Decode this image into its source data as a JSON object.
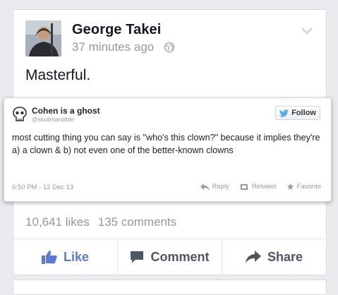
{
  "post": {
    "author": "George Takei",
    "time": "37 minutes ago",
    "text": "Masterful.",
    "likes": "10,641 likes",
    "comments": "135 comments"
  },
  "tweet": {
    "name": "Cohen is a ghost",
    "handle": "@skullmandible",
    "follow_label": "Follow",
    "text": "most cutting thing you can say is \"who's this clown?\" because it implies they're a) a clown & b) not even one of the better-known clowns",
    "date": "6:50 PM - 12 Dec 13",
    "reply_label": "Reply",
    "retweet_label": "Retweet",
    "favorite_label": "Favorite"
  },
  "actions": {
    "like": "Like",
    "comment": "Comment",
    "share": "Share"
  },
  "colors": {
    "accent_blue": "#5b7bd5",
    "twitter_blue": "#55acee",
    "muted_text": "#9197a3"
  },
  "icons": [
    "globe-icon",
    "chevron-down-icon",
    "skull-icon",
    "twitter-bird-icon",
    "reply-icon",
    "retweet-icon",
    "favorite-star-icon",
    "thumbs-up-icon",
    "comment-icon",
    "share-arrow-icon"
  ]
}
